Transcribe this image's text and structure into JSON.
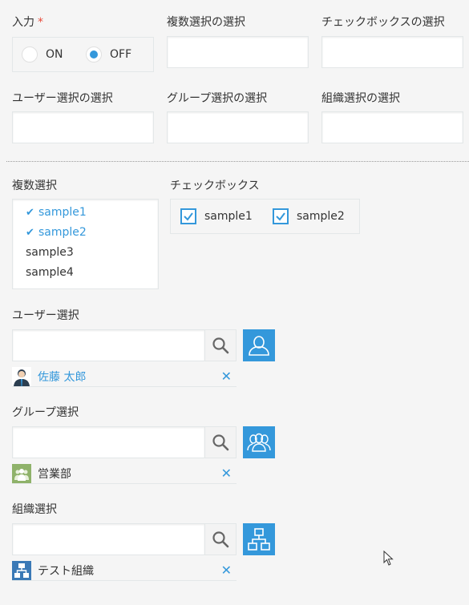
{
  "radio_field": {
    "label": "入力",
    "required_mark": "*",
    "options": [
      {
        "label": "ON",
        "selected": false
      },
      {
        "label": "OFF",
        "selected": true
      }
    ]
  },
  "top_fields": [
    {
      "label": "複数選択の選択",
      "value": ""
    },
    {
      "label": "チェックボックスの選択",
      "value": ""
    },
    {
      "label": "ユーザー選択の選択",
      "value": ""
    },
    {
      "label": "グループ選択の選択",
      "value": ""
    },
    {
      "label": "組織選択の選択",
      "value": ""
    }
  ],
  "multi_select": {
    "label": "複数選択",
    "check_glyph": "✔",
    "options": [
      {
        "label": "sample1",
        "selected": true
      },
      {
        "label": "sample2",
        "selected": true
      },
      {
        "label": "sample3",
        "selected": false
      },
      {
        "label": "sample4",
        "selected": false
      }
    ]
  },
  "checkbox_field": {
    "label": "チェックボックス",
    "options": [
      {
        "label": "sample1",
        "checked": true
      },
      {
        "label": "sample2",
        "checked": true
      }
    ]
  },
  "user_select": {
    "label": "ユーザー選択",
    "input_value": "",
    "selected_name": "佐藤 太郎",
    "remove_glyph": "✕"
  },
  "group_select": {
    "label": "グループ選択",
    "input_value": "",
    "selected_name": "営業部",
    "remove_glyph": "✕"
  },
  "org_select": {
    "label": "組織選択",
    "input_value": "",
    "selected_name": "テスト組織",
    "remove_glyph": "✕"
  },
  "colors": {
    "accent": "#3498db",
    "required": "#e74c3c",
    "background": "#f5f5f5"
  },
  "icons": {
    "search": "search-icon",
    "user_picker": "user-icon",
    "group_picker": "group-icon",
    "org_picker": "org-chart-icon"
  }
}
